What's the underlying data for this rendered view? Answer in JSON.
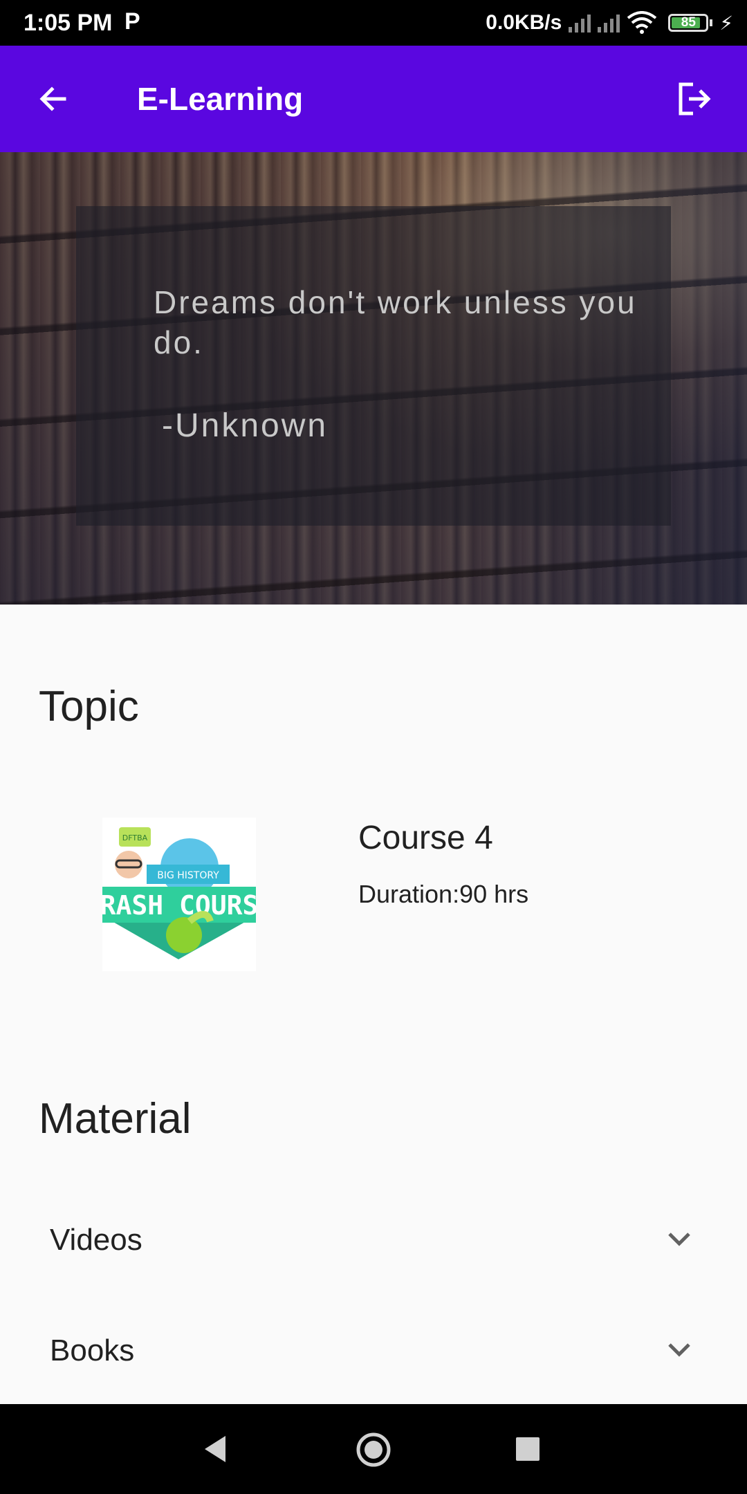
{
  "status_bar": {
    "time": "1:05 PM",
    "carrier_icon": "P",
    "network_speed": "0.0KB/s",
    "battery_percent": "85",
    "battery_level": 0.85,
    "charging_icon": "⚡"
  },
  "app_bar": {
    "title": "E-Learning",
    "back_icon": "arrow-left-icon",
    "logout_icon": "logout-icon",
    "color": "#5a07e0"
  },
  "hero": {
    "quote": "Dreams don't work unless you do.",
    "author": "-Unknown"
  },
  "topic": {
    "heading": "Topic",
    "course": {
      "title": "Course 4",
      "duration": "Duration:90 hrs",
      "thumbnail": {
        "badge": "DFTBA",
        "subtitle": "BIG HISTORY",
        "title": "CRASH COURSE"
      }
    }
  },
  "material": {
    "heading": "Material",
    "items": [
      {
        "label": "Videos"
      },
      {
        "label": "Books"
      }
    ]
  }
}
